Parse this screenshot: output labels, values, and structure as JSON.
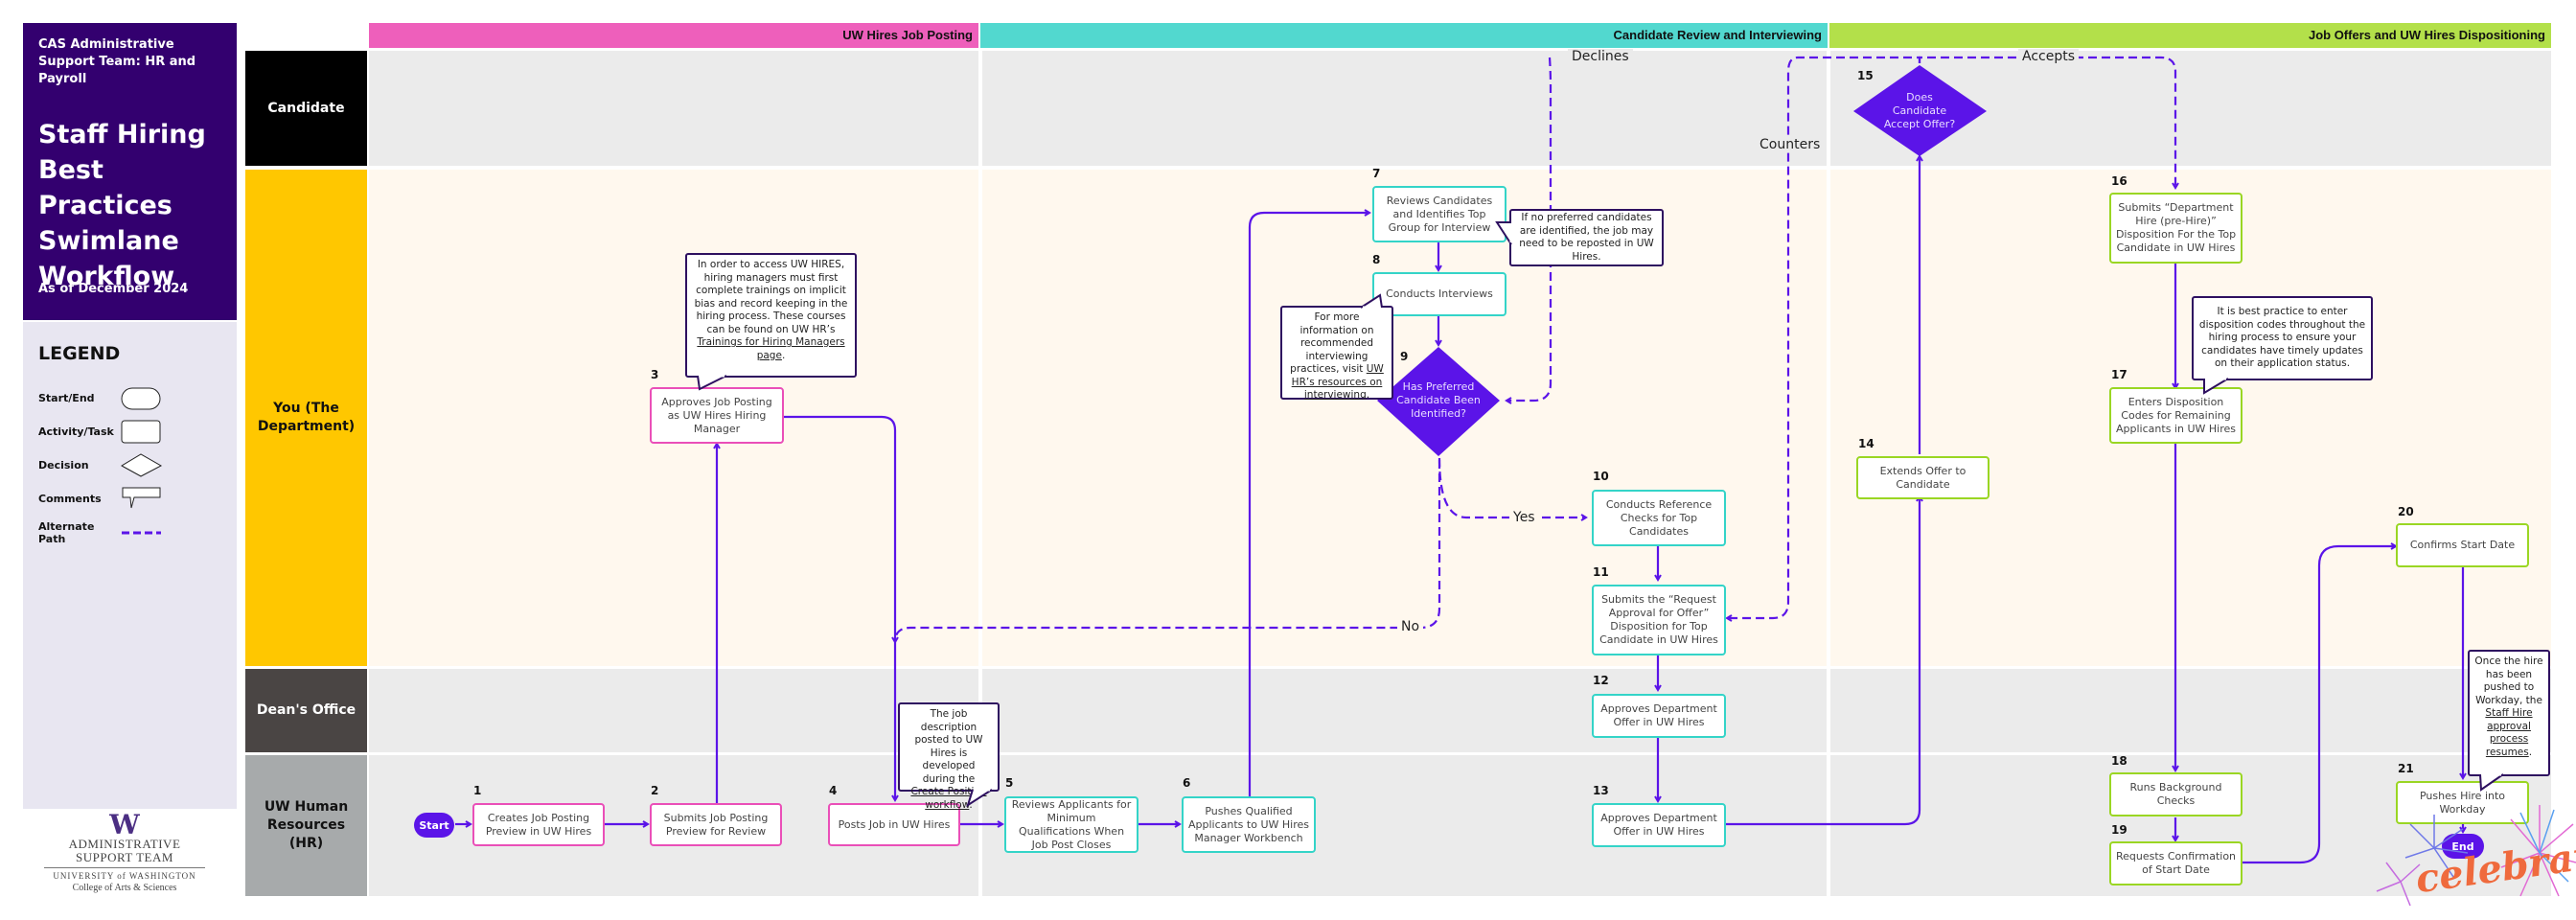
{
  "title_panel": {
    "org": "CAS Administrative Support Team: HR and Payroll",
    "title": "Staff Hiring Best Practices Swimlane Workflow",
    "date": "As of December 2024"
  },
  "legend": {
    "heading": "LEGEND",
    "items": [
      {
        "label": "Start/End",
        "shape": "rounded-pill"
      },
      {
        "label": "Activity/Task",
        "shape": "rectangle"
      },
      {
        "label": "Decision",
        "shape": "diamond"
      },
      {
        "label": "Comments",
        "shape": "callout"
      },
      {
        "label": "Alternate Path",
        "shape": "dashed-line"
      }
    ]
  },
  "logo": {
    "mark": "W",
    "line1": "ADMINISTRATIVE",
    "line2": "SUPPORT TEAM",
    "line3": "UNIVERSITY of WASHINGTON",
    "line4": "College of Arts & Sciences"
  },
  "colors": {
    "title_bg": "#33006f",
    "accent": "#5b14e8",
    "phase_posting": "#ee5fbb",
    "phase_review": "#52d8cf",
    "phase_offers": "#b3e04a",
    "lane_candidate": "#000000",
    "lane_department": "#ffc700",
    "lane_deans": "#4a4544",
    "lane_hr": "#a7aaab"
  },
  "phases": [
    {
      "label": "UW Hires Job Posting"
    },
    {
      "label": "Candidate Review and Interviewing"
    },
    {
      "label": "Job Offers and UW Hires Dispositioning"
    }
  ],
  "lanes": [
    {
      "label": "Candidate"
    },
    {
      "label": "You (The Department)"
    },
    {
      "label": "Dean's Office"
    },
    {
      "label": "UW Human Resources (HR)"
    }
  ],
  "start_label": "Start",
  "end_label": "End",
  "steps": [
    {
      "num": "1",
      "text": "Creates Job Posting Preview in UW Hires"
    },
    {
      "num": "2",
      "text": "Submits Job Posting Preview for Review"
    },
    {
      "num": "3",
      "text": "Approves Job Posting as UW Hires Hiring Manager"
    },
    {
      "num": "4",
      "text": "Posts Job in UW Hires"
    },
    {
      "num": "5",
      "text": "Reviews Applicants for Minimum Qualifications When Job Post Closes"
    },
    {
      "num": "6",
      "text": "Pushes Qualified Applicants to UW Hires Manager Workbench"
    },
    {
      "num": "7",
      "text": "Reviews Candidates and Identifies Top Group for Interview"
    },
    {
      "num": "8",
      "text": "Conducts Interviews"
    },
    {
      "num": "9",
      "text": "Has Preferred Candidate Been Identified?"
    },
    {
      "num": "10",
      "text": "Conducts Reference Checks for Top Candidates"
    },
    {
      "num": "11",
      "text": "Submits the “Request Approval for Offer” Disposition for Top Candidate in UW Hires"
    },
    {
      "num": "12",
      "text": "Approves Department Offer in UW Hires"
    },
    {
      "num": "13",
      "text": "Approves Department Offer in UW Hires"
    },
    {
      "num": "14",
      "text": "Extends Offer to Candidate"
    },
    {
      "num": "15",
      "text": "Does Candidate Accept Offer?"
    },
    {
      "num": "16",
      "text": "Submits “Department Hire (pre-Hire)” Disposition For the Top Candidate in UW Hires"
    },
    {
      "num": "17",
      "text": "Enters Disposition Codes for Remaining Applicants in UW Hires"
    },
    {
      "num": "18",
      "text": "Runs Background Checks"
    },
    {
      "num": "19",
      "text": "Requests Confirmation of Start Date"
    },
    {
      "num": "20",
      "text": "Confirms Start Date"
    },
    {
      "num": "21",
      "text": "Pushes Hire into Workday"
    }
  ],
  "comments": {
    "c3_pre": "In order to access UW HIRES, hiring managers must first complete trainings on implicit bias and record keeping in the hiring process. These courses can be found on UW HR’s",
    "c3_link": "Trainings for Hiring Managers page",
    "c4_pre": "The job description posted to UW Hires is developed during the",
    "c4_link": "Create Position workflow",
    "c7": "If no preferred candidates are identified, the job may need to be reposted in UW Hires.",
    "c8_pre": "For more information on recommended interviewing practices, visit",
    "c8_link": "UW HR’s resources on interviewing",
    "c17": "It is best practice to enter disposition codes throughout the hiring process to ensure your candidates have timely updates on their application status.",
    "c21_pre": "Once the hire has been pushed to Workday, the",
    "c21_link": "Staff Hire approval process resumes",
    "period": "."
  },
  "edge_labels": {
    "yes": "Yes",
    "no": "No",
    "declines": "Declines",
    "accepts": "Accepts",
    "counters": "Counters"
  },
  "decoration": {
    "celebrate": "celebrate"
  }
}
